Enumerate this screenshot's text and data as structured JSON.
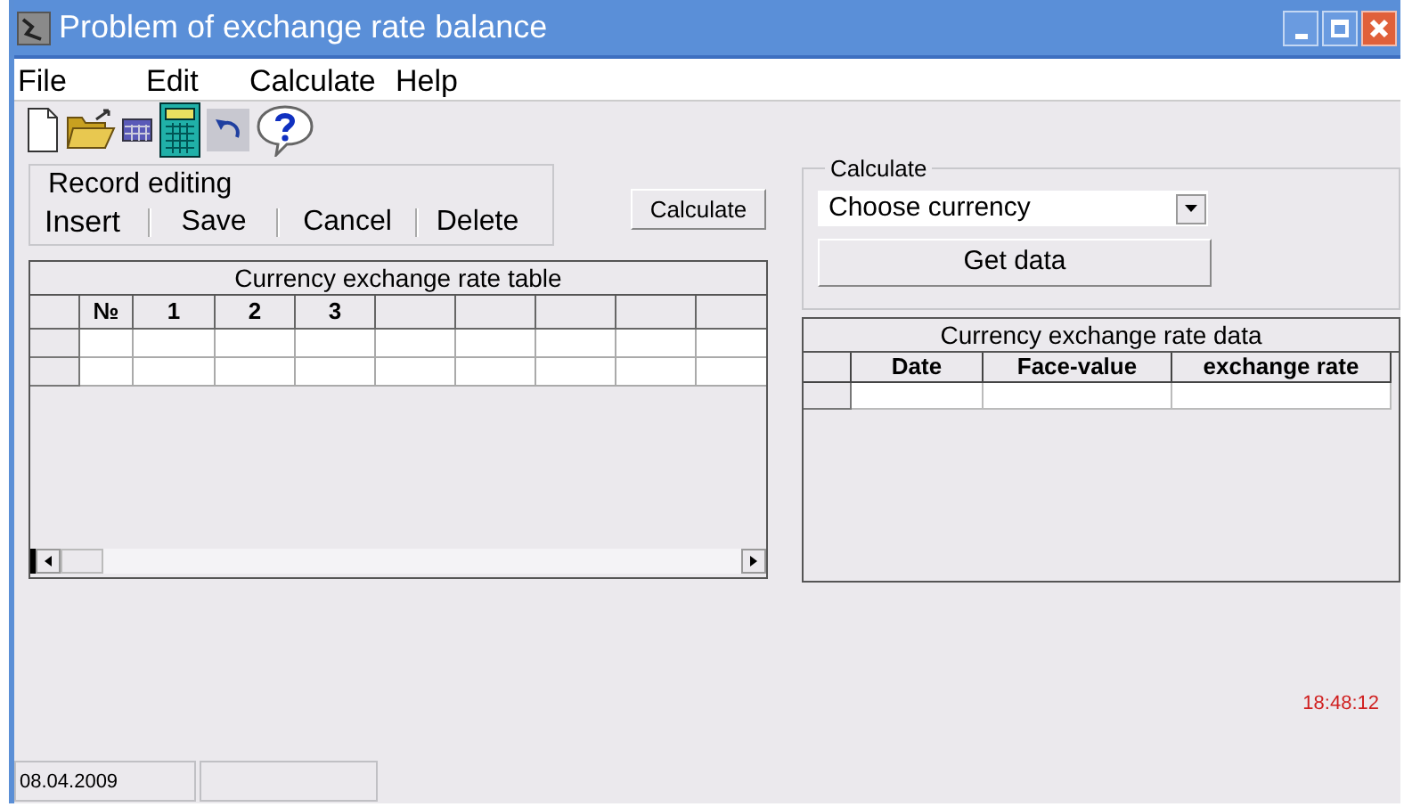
{
  "window": {
    "title": "Problem of exchange rate balance"
  },
  "menu": [
    "File",
    "Edit",
    "Calculate",
    "Help"
  ],
  "record_editing": {
    "label": "Record editing",
    "buttons": [
      "Insert",
      "Save",
      "Cancel",
      "Delete"
    ]
  },
  "calculate_button": "Calculate",
  "rate_table": {
    "title": "Currency exchange rate table",
    "columns": [
      "№",
      "1",
      "2",
      "3"
    ]
  },
  "calculate_group": {
    "legend": "Calculate",
    "currency_select": {
      "value": "Choose currency"
    },
    "get_data_button": "Get data"
  },
  "rate_data": {
    "title": "Currency exchange rate data",
    "columns": [
      "Date",
      "Face-value",
      "exchange rate"
    ]
  },
  "clock": "18:48:12",
  "status_bar": {
    "date": "08.04.2009"
  }
}
